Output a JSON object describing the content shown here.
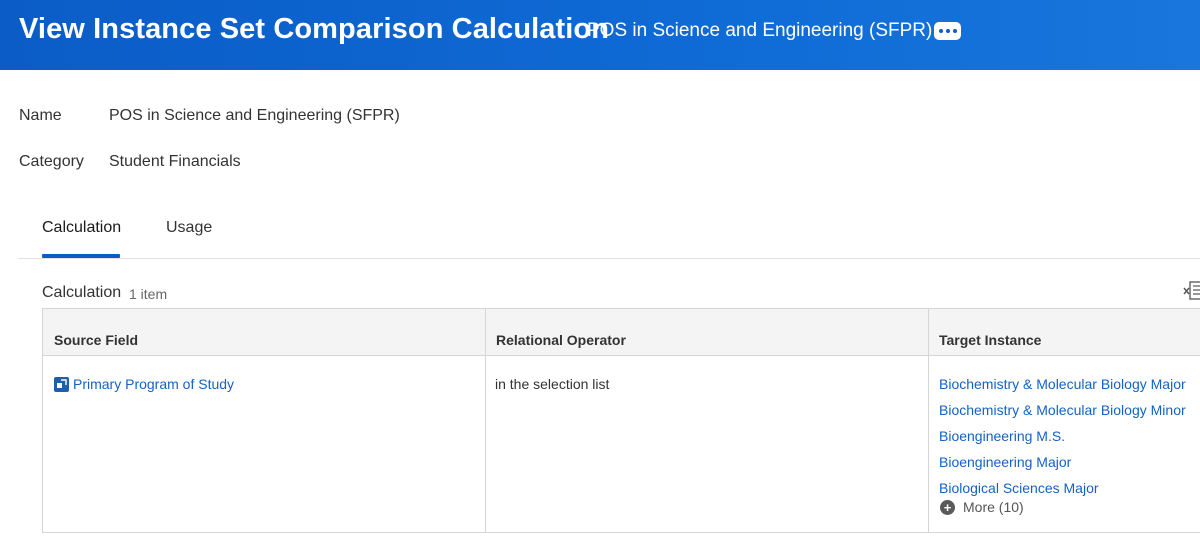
{
  "header": {
    "title": "View Instance Set Comparison Calculation",
    "subtitle": "POS in Science and Engineering (SFPR)",
    "more_icon": "ellipsis-icon"
  },
  "fields": {
    "name_label": "Name",
    "name_value": "POS in Science and Engineering (SFPR)",
    "category_label": "Category",
    "category_value": "Student Financials"
  },
  "tabs": [
    {
      "label": "Calculation",
      "active": true
    },
    {
      "label": "Usage",
      "active": false
    }
  ],
  "section": {
    "title": "Calculation",
    "count": "1 item",
    "export_icon": "export-to-excel-icon"
  },
  "table": {
    "columns": [
      "Source Field",
      "Relational Operator",
      "Target Instance"
    ],
    "rows": [
      {
        "source_field": "Primary Program of Study",
        "relational_operator": "in the selection list",
        "target_instances": [
          "Biochemistry & Molecular Biology Major",
          "Biochemistry & Molecular Biology Minor",
          "Bioengineering M.S.",
          "Bioengineering Major",
          "Biological Sciences Major"
        ],
        "more_label": "More (10)"
      }
    ]
  },
  "colors": {
    "header_bg": "#0b5cc7",
    "link": "#1362c5",
    "tab_active_underline": "#0b5cc7"
  }
}
